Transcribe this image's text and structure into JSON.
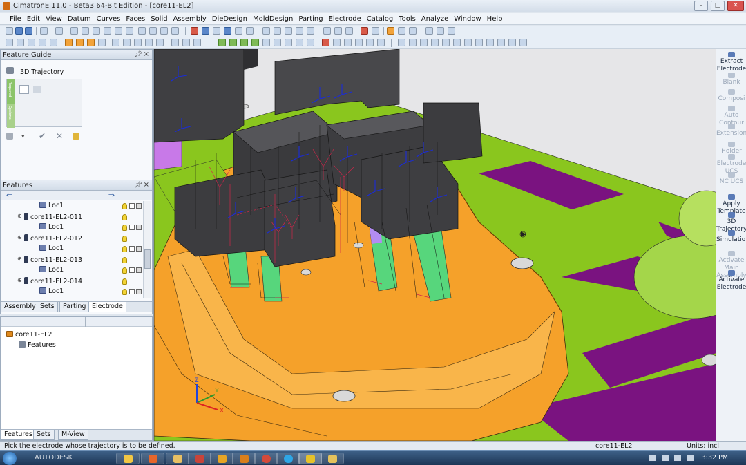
{
  "window": {
    "title": "CimatronE 11.0 - Beta3 64-Bit Edition - [core11-EL2]",
    "minimize": "–",
    "maximize": "□",
    "close": "✕"
  },
  "menu": [
    "File",
    "Edit",
    "View",
    "Datum",
    "Curves",
    "Faces",
    "Solid",
    "Assembly",
    "DieDesign",
    "MoldDesign",
    "Parting",
    "Electrode",
    "Catalog",
    "Tools",
    "Analyze",
    "Window",
    "Help"
  ],
  "feature_guide": {
    "header": "Feature Guide",
    "feature": "3D Trajectory",
    "required_label": "Required",
    "optional_label": "Optional"
  },
  "features_panel": {
    "header": "Features",
    "items": [
      {
        "label": "Loc1",
        "level": 2
      },
      {
        "label": "core11-EL2-011",
        "level": 1
      },
      {
        "label": "Loc1",
        "level": 2
      },
      {
        "label": "core11-EL2-012",
        "level": 1
      },
      {
        "label": "Loc1",
        "level": 2
      },
      {
        "label": "core11-EL2-013",
        "level": 1
      },
      {
        "label": "Loc1",
        "level": 2
      },
      {
        "label": "core11-EL2-014",
        "level": 1
      },
      {
        "label": "Loc1",
        "level": 2
      }
    ],
    "tabs": [
      "Assembly",
      "Sets",
      "Parting",
      "Electrode"
    ],
    "active_tab": "Electrode"
  },
  "assembly_tree": {
    "root": "core11-EL2",
    "child": "Features",
    "tabs": [
      "Features",
      "Sets",
      "M-View"
    ],
    "active_tab": "Features"
  },
  "right_toolbar": [
    {
      "label": "Extract Electrode",
      "enabled": true
    },
    {
      "label": "Blank",
      "enabled": false
    },
    {
      "label": "Composi",
      "enabled": false
    },
    {
      "label": "Auto Contour",
      "enabled": false
    },
    {
      "label": "Extension",
      "enabled": false
    },
    {
      "label": "Holder",
      "enabled": false
    },
    {
      "label": "Electrode UCS",
      "enabled": false
    },
    {
      "label": "NC UCS",
      "enabled": false
    },
    {
      "label": "Apply Template",
      "enabled": true
    },
    {
      "label": "3D Trajectory",
      "enabled": true
    },
    {
      "label": "Simulation",
      "enabled": true
    },
    {
      "label": "Activate Main Assembly",
      "enabled": false
    },
    {
      "label": "Activate Electrode",
      "enabled": true
    }
  ],
  "viewport": {
    "triad": {
      "z": "Z",
      "y": "Y",
      "x": "X"
    }
  },
  "status": {
    "message": "Pick the electrode whose trajectory is to be defined.",
    "model": "core11-EL2",
    "units": "Units: incl"
  },
  "taskbar": {
    "time": "3:32 PM",
    "watermark": "AUTODESK"
  },
  "colors": {
    "orange": "#f5a12a",
    "green": "#8ac61e",
    "purple": "#7a1380",
    "gray_electrode": "#3f3f42",
    "background": "#e6e6e8"
  }
}
